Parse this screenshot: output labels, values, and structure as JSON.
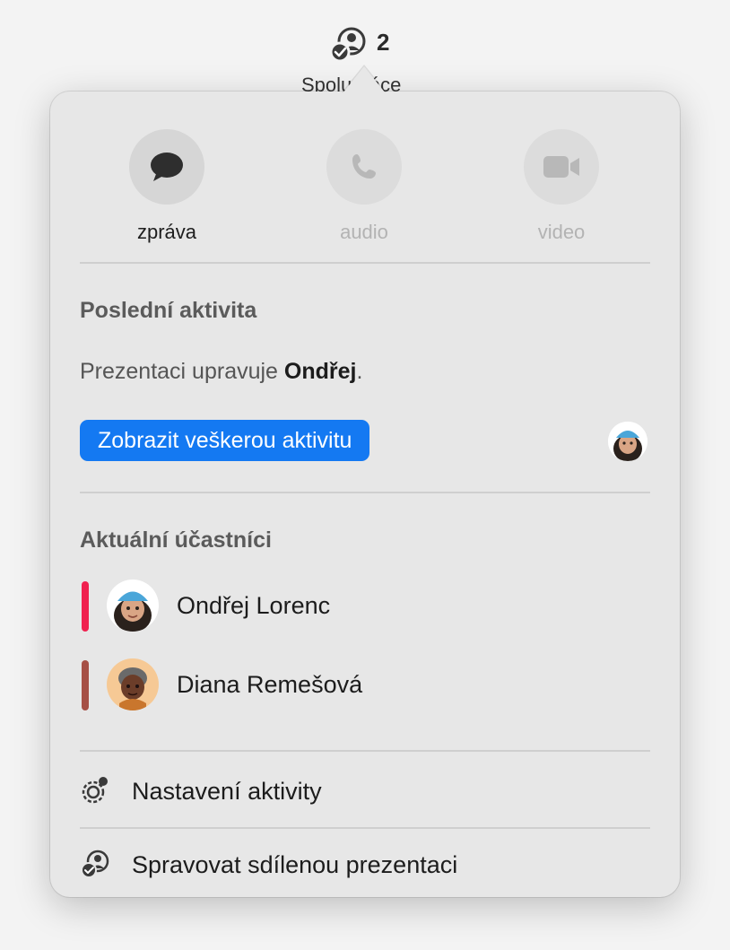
{
  "toolbar": {
    "collaborate_count": "2",
    "collaborate_label": "Spolupráce"
  },
  "comm": {
    "message_label": "zpráva",
    "audio_label": "audio",
    "video_label": "video"
  },
  "recent_activity": {
    "heading": "Poslední aktivita",
    "text_prefix": "Prezentaci upravuje ",
    "editor_name": "Ondřej",
    "text_suffix": ".",
    "show_all_button": "Zobrazit veškerou aktivitu"
  },
  "participants": {
    "heading": "Aktuální účastníci",
    "items": [
      {
        "name": "Ondřej Lorenc",
        "color": "#f0214f"
      },
      {
        "name": "Diana Remešová",
        "color": "#a65046"
      }
    ]
  },
  "menu": {
    "activity_settings": "Nastavení aktivity",
    "manage_shared": "Spravovat sdílenou prezentaci"
  },
  "colors": {
    "accent": "#1479f2",
    "popover_bg": "#e7e7e7"
  }
}
